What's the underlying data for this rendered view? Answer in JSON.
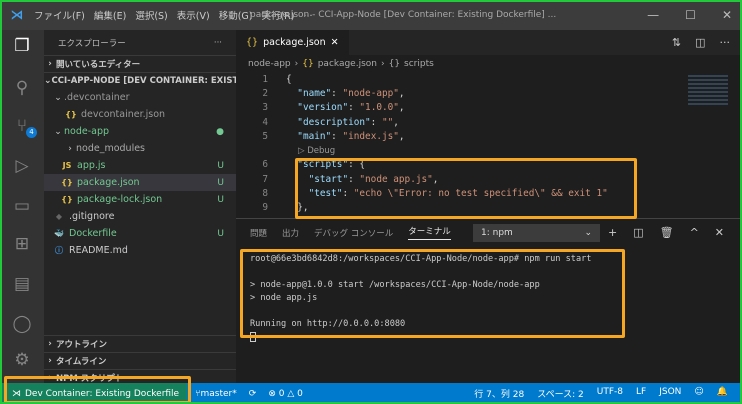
{
  "titlebar": {
    "menus": [
      "ファイル(F)",
      "編集(E)",
      "選択(S)",
      "表示(V)",
      "移動(G)",
      "実行(R)",
      "···"
    ],
    "title": "package.json - CCI-App-Node [Dev Container: Existing Dockerfile] ..."
  },
  "activity": {
    "scm_badge": "4"
  },
  "sidebar": {
    "title": "エクスプローラー",
    "more": "···",
    "open_editors": "開いているエディター",
    "root": "CCI-APP-NODE [DEV CONTAINER: EXISTIN...",
    "items": [
      {
        "label": ".devcontainer",
        "icon": "",
        "status": ""
      },
      {
        "label": "devcontainer.json",
        "icon": "{}",
        "status": ""
      },
      {
        "label": "node-app",
        "icon": "",
        "status": "●"
      },
      {
        "label": "node_modules",
        "icon": "",
        "status": ""
      },
      {
        "label": "app.js",
        "icon": "JS",
        "status": "U"
      },
      {
        "label": "package.json",
        "icon": "{}",
        "status": "U"
      },
      {
        "label": "package-lock.json",
        "icon": "{}",
        "status": "U"
      },
      {
        "label": ".gitignore",
        "icon": "◆",
        "status": ""
      },
      {
        "label": "Dockerfile",
        "icon": "🐳",
        "status": "U"
      },
      {
        "label": "README.md",
        "icon": "ⓘ",
        "status": ""
      }
    ],
    "sections": [
      "アウトライン",
      "タイムライン",
      "NPM スクリプト"
    ]
  },
  "editor": {
    "tab": "package.json",
    "breadcrumb": [
      "node-app",
      "package.json",
      "scripts"
    ],
    "codelens": "Debug",
    "lines": [
      {
        "n": "1",
        "t": [
          [
            "p",
            "{"
          ]
        ]
      },
      {
        "n": "2",
        "t": [
          [
            "p",
            "  "
          ],
          [
            "k",
            "\"name\""
          ],
          [
            "p",
            ": "
          ],
          [
            "s",
            "\"node-app\""
          ],
          [
            "p",
            ","
          ]
        ]
      },
      {
        "n": "3",
        "t": [
          [
            "p",
            "  "
          ],
          [
            "k",
            "\"version\""
          ],
          [
            "p",
            ": "
          ],
          [
            "s",
            "\"1.0.0\""
          ],
          [
            "p",
            ","
          ]
        ]
      },
      {
        "n": "4",
        "t": [
          [
            "p",
            "  "
          ],
          [
            "k",
            "\"description\""
          ],
          [
            "p",
            ": "
          ],
          [
            "s",
            "\"\""
          ],
          [
            "p",
            ","
          ]
        ]
      },
      {
        "n": "5",
        "t": [
          [
            "p",
            "  "
          ],
          [
            "k",
            "\"main\""
          ],
          [
            "p",
            ": "
          ],
          [
            "s",
            "\"index.js\""
          ],
          [
            "p",
            ","
          ]
        ]
      },
      {
        "n": "6",
        "t": [
          [
            "p",
            "  "
          ],
          [
            "k",
            "\"scripts\""
          ],
          [
            "p",
            ": {"
          ]
        ]
      },
      {
        "n": "7",
        "t": [
          [
            "p",
            "    "
          ],
          [
            "k",
            "\"start\""
          ],
          [
            "p",
            ": "
          ],
          [
            "s",
            "\"node app.js\""
          ],
          [
            "p",
            ","
          ]
        ]
      },
      {
        "n": "8",
        "t": [
          [
            "p",
            "    "
          ],
          [
            "k",
            "\"test\""
          ],
          [
            "p",
            ": "
          ],
          [
            "s",
            "\"echo \\\"Error: no test specified\\\" && exit 1\""
          ]
        ]
      },
      {
        "n": "9",
        "t": [
          [
            "p",
            "  },"
          ]
        ]
      }
    ]
  },
  "panel": {
    "tabs": [
      "問題",
      "出力",
      "デバッグ コンソール",
      "ターミナル"
    ],
    "terminal_select": "1: npm",
    "terminal": [
      "root@66e3bd6842d8:/workspaces/CCI-App-Node/node-app# npm run start",
      "",
      "> node-app@1.0.0 start /workspaces/CCI-App-Node/node-app",
      "> node app.js",
      "",
      "Running on http://0.0.0.0:8080"
    ]
  },
  "status": {
    "remote": "Dev Container: Existing Dockerfile",
    "branch": "master*",
    "errors": "0",
    "warnings": "0",
    "position": "行 7、列 28",
    "spaces": "スペース: 2",
    "encoding": "UTF-8",
    "eol": "LF",
    "language": "JSON"
  }
}
